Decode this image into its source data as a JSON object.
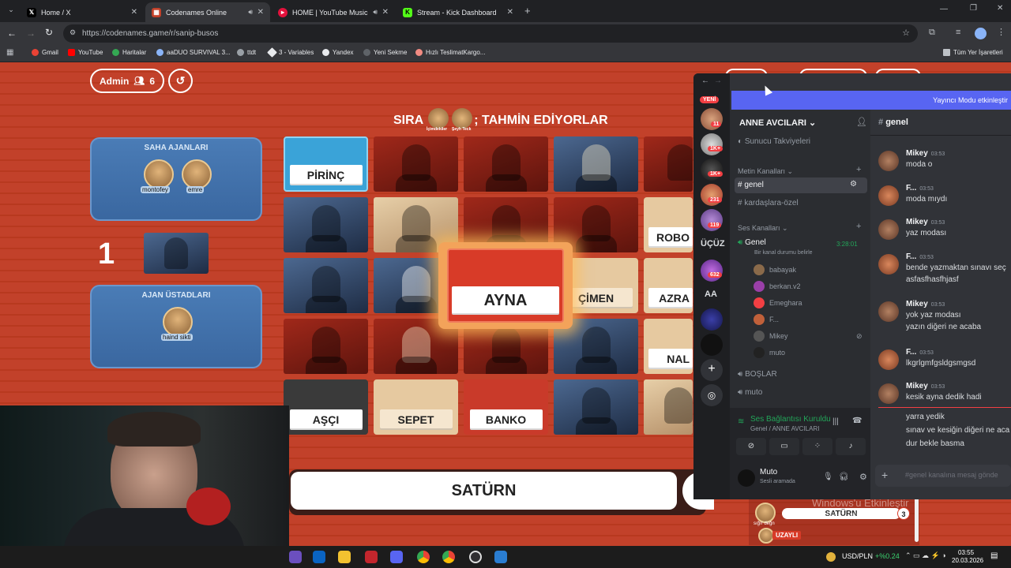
{
  "browser": {
    "tabs": [
      {
        "label": "Home / X",
        "icon": "x-logo-icon"
      },
      {
        "label": "Codenames Online",
        "icon": "codenames-icon"
      },
      {
        "label": "HOME | YouTube Music",
        "icon": "youtube-music-icon"
      },
      {
        "label": "Stream - Kick Dashboard",
        "icon": "kick-icon"
      }
    ],
    "url": "https://codenames.game/r/sanip-busos",
    "bookmarks": [
      "Gmail",
      "YouTube",
      "Haritalar",
      "aaDUO SURVIVAL 3...",
      "ttdt",
      "3 - Variables",
      "Yandex",
      "Yeni Sekme",
      "Hızlı TeslimatKargo..."
    ],
    "all_bookmarks": "Tüm Yer İşaretleri"
  },
  "game": {
    "admin_label": "Admin",
    "player_count": "6",
    "turn_prefix": "SIRA",
    "turn_players": [
      "İçimdekiler",
      "Şeyh Teck"
    ],
    "turn_suffix": "; TAHMİN EDİYORLAR",
    "blue_team": {
      "operatives_title": "SAHA AJANLARI",
      "operatives": [
        "montofey",
        "emre"
      ],
      "spymasters_title": "AJAN ÜSTADLARI",
      "spymasters": [
        "haind sikti"
      ],
      "score": "1"
    },
    "cards": {
      "pirinc": "PİRİNÇ",
      "robo": "ROBO",
      "cimen": "ÇİMEN",
      "azra": "AZRA",
      "nal": "NAL",
      "asci": "AŞÇI",
      "sepet": "SEPET",
      "banko": "BANKO",
      "ayna": "AYNA"
    },
    "clue_word": "SATÜRN",
    "log_clue": "SATÜRN",
    "log_count": "3",
    "log_uzayli": "UZAYLI",
    "log_player": "sığır değn",
    "windows_watermark": "Windows'u Etkinleştir",
    "windows_watermark_sub": "Windows'u etkinleştirme"
  },
  "discord": {
    "new_label": "YENİ",
    "streamer_banner": "Yayıncı Modu etkinleştir",
    "server_name": "ANNE AVCILARI",
    "server_badges": [
      "11",
      "1K+",
      "1K+",
      "231",
      "119",
      "632"
    ],
    "server_labels": [
      "ÜÇÜZ",
      "AA"
    ],
    "boosts": "Sunucu Takviyeleri",
    "text_category": "Metin Kanalları",
    "text_channels": [
      "genel",
      "kardaşlara-özel"
    ],
    "voice_category": "Ses Kanalları",
    "voice_channel": "Genel",
    "voice_timer": "3:28:01",
    "voice_status": "Bir kanal durumu belirle",
    "voice_users": [
      "babayak",
      "berkan.v2",
      "Emeghara",
      "F...",
      "Mikey",
      "muto"
    ],
    "other_voice": [
      "BOŞLAR",
      "muto"
    ],
    "connection_title": "Ses Bağlantısı Kuruldu",
    "connection_sub": "Genel / ANNE AVCILARI",
    "user_name": "Muto",
    "user_status": "Sesli aramada",
    "active_channel": "genel",
    "messages": [
      {
        "author": "Mikey",
        "time": "03:53",
        "lines": [
          "moda o"
        ]
      },
      {
        "author": "F...",
        "time": "03:53",
        "lines": [
          "moda mıydı"
        ]
      },
      {
        "author": "Mikey",
        "time": "03:53",
        "lines": [
          "yaz modası"
        ]
      },
      {
        "author": "F...",
        "time": "03:53",
        "lines": [
          "bende yazmaktan sınavı seç",
          "asfasfhasfhjasf"
        ]
      },
      {
        "author": "Mikey",
        "time": "03:53",
        "lines": [
          "yok yaz modası",
          "yazın diğeri ne acaba"
        ]
      },
      {
        "author": "F...",
        "time": "03:53",
        "lines": [
          "lkgrlgmfgsldgsmgsd"
        ]
      },
      {
        "author": "Mikey",
        "time": "03:53",
        "lines": [
          "kesik ayna dedik hadi"
        ]
      }
    ],
    "trailing_lines": [
      "yarra yedik",
      "sınav ve kesiğin diğeri ne aca",
      "dur bekle basma"
    ],
    "input_placeholder": "#genel kanalına mesaj gönde"
  },
  "taskbar": {
    "ticker": "USD/PLN",
    "ticker_change": "+%0.24",
    "time": "03:55",
    "date": "20.03.2026"
  },
  "colors": {
    "game_red": "#c2412a",
    "team_blue": "#4a7cb6",
    "discord_purple": "#5865f2",
    "discord_bg": "#313338"
  }
}
